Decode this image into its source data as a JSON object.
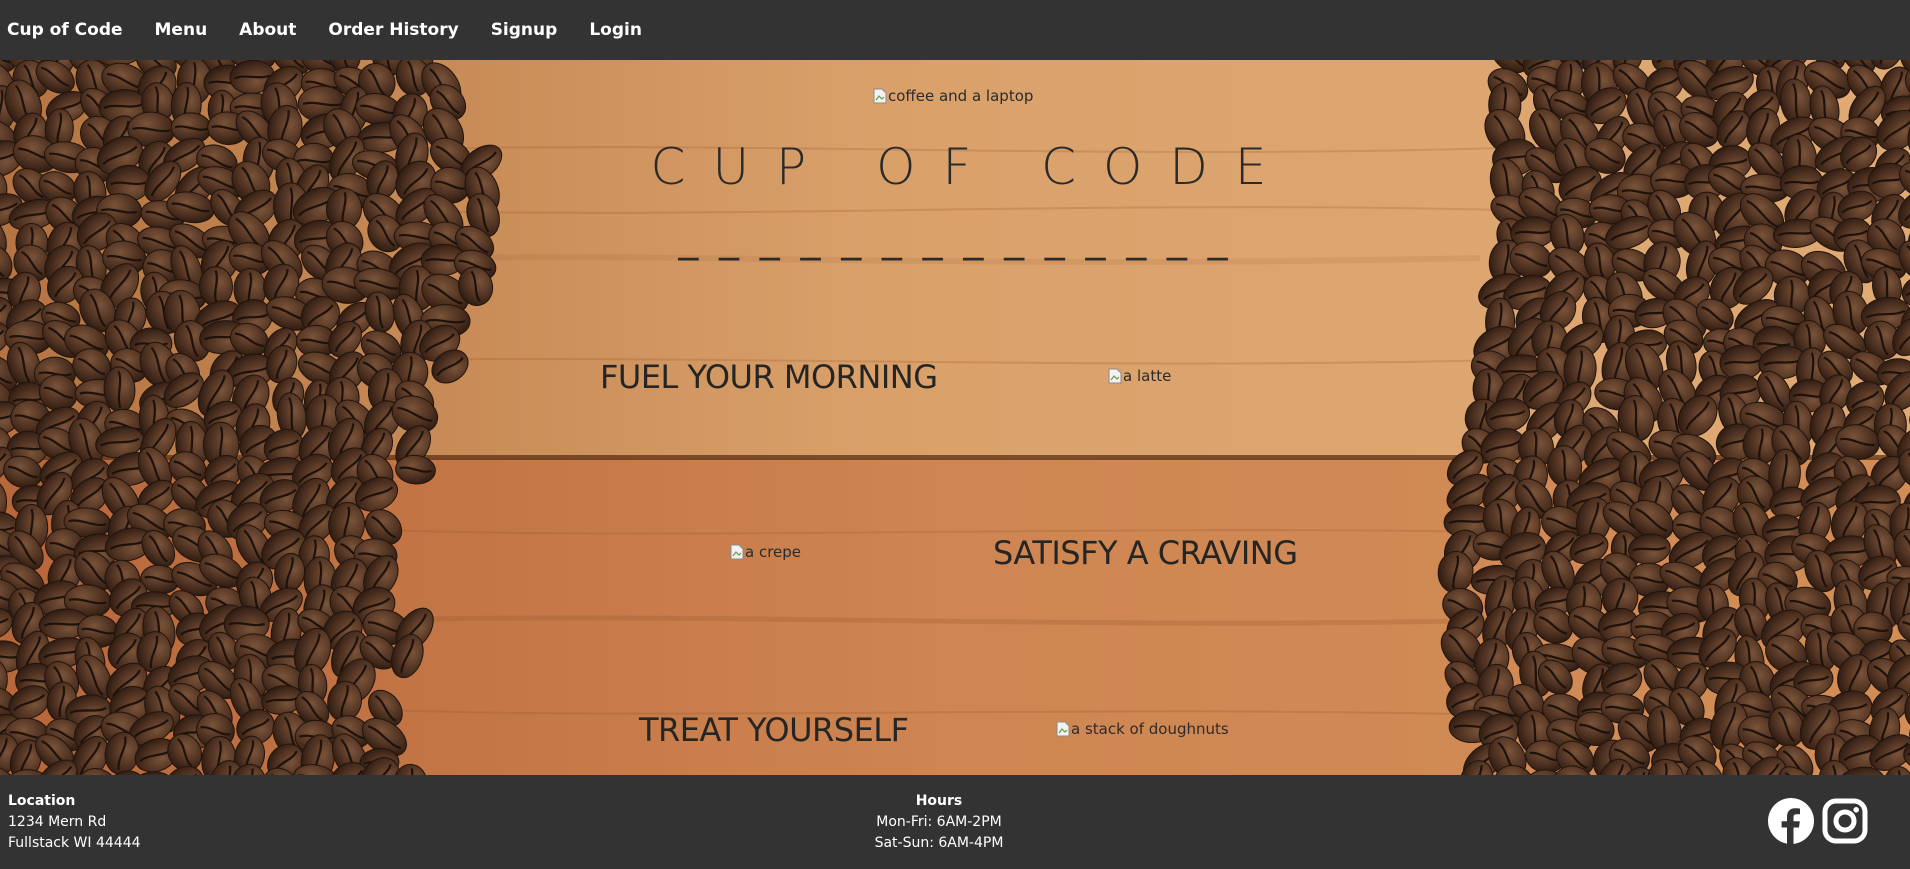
{
  "nav": {
    "brand": "Cup of Code",
    "links": [
      "Menu",
      "About",
      "Order History",
      "Signup",
      "Login"
    ]
  },
  "hero": {
    "top_image_alt": "coffee and a laptop",
    "title": "CUP OF CODE",
    "dashes": "_ _ _ _ _ _ _ _ _ _ _ _ _ _",
    "sections": [
      {
        "tagline": "FUEL YOUR MORNING",
        "image_alt": "a latte"
      },
      {
        "tagline": "SATISFY A CRAVING",
        "image_alt": "a crepe"
      },
      {
        "tagline": "TREAT YOURSELF",
        "image_alt": "a stack of doughnuts"
      }
    ]
  },
  "footer": {
    "location": {
      "title": "Location",
      "line1": "1234 Mern Rd",
      "line2": "Fullstack WI 44444"
    },
    "hours": {
      "title": "Hours",
      "line1": "Mon-Fri: 6AM-2PM",
      "line2": "Sat-Sun: 6AM-4PM"
    },
    "social": [
      "facebook-icon",
      "instagram-icon"
    ]
  },
  "colors": {
    "bar": "#333333",
    "wood": "#c78a52",
    "bean": "#4a2e1f",
    "text_dark": "#252525"
  }
}
